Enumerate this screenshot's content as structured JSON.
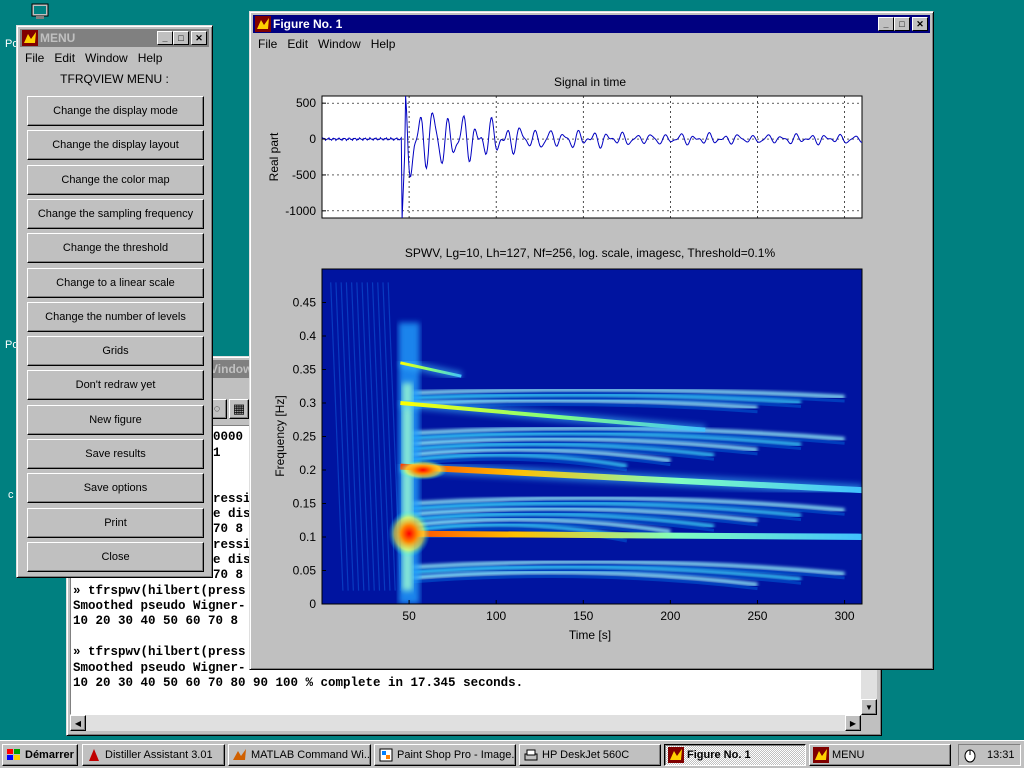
{
  "desktop": {
    "labels": [
      "Po",
      "Po",
      "c"
    ]
  },
  "menu_window": {
    "title": "MENU",
    "menus": [
      "File",
      "Edit",
      "Window",
      "Help"
    ],
    "heading": "TFRQVIEW MENU :",
    "buttons": [
      "Change the display mode",
      "Change the display layout",
      "Change the color map",
      "Change the sampling frequency",
      "Change the threshold",
      "Change to a linear scale",
      "Change the number of levels",
      "Grids",
      "Don't redraw yet",
      "New figure",
      "Save results",
      "Save options",
      "Print",
      "Close"
    ]
  },
  "command_window": {
    "title_fragment": "Vindow",
    "lines": [
      "0000",
      "1",
      "",
      "ressi",
      "e dis",
      "70 8",
      "ressi",
      "e dis",
      "70 8",
      "» tfrspwv(hilbert(press",
      "Smoothed pseudo Wigner-",
      "10 20 30 40 50 60 70 8",
      "",
      "» tfrspwv(hilbert(press",
      "Smoothed pseudo Wigner-",
      "10 20 30 40 50 60 70 80 90 100 % complete in 17.345 seconds."
    ]
  },
  "figure_window": {
    "title": "Figure No. 1",
    "menus": [
      "File",
      "Edit",
      "Window",
      "Help"
    ],
    "top_plot": {
      "title": "Signal in time",
      "ylabel": "Real part",
      "yticks": [
        "500",
        "0",
        "-500",
        "-1000"
      ]
    },
    "bottom_plot": {
      "title": "SPWV, Lg=10, Lh=127, Nf=256, log. scale, imagesc, Threshold=0.1%",
      "ylabel": "Frequency [Hz]",
      "xlabel": "Time [s]",
      "yticks": [
        "0.45",
        "0.4",
        "0.35",
        "0.3",
        "0.25",
        "0.2",
        "0.15",
        "0.1",
        "0.05",
        "0"
      ],
      "xticks": [
        "50",
        "100",
        "150",
        "200",
        "250",
        "300"
      ]
    }
  },
  "chart_data": [
    {
      "type": "line",
      "title": "Signal in time",
      "xlabel": "",
      "ylabel": "Real part",
      "ylim": [
        -1100,
        600
      ],
      "xlim": [
        0,
        310
      ],
      "grid": true,
      "x": [
        0,
        20,
        40,
        46,
        48,
        50,
        52,
        54,
        56,
        58,
        60,
        62,
        64,
        66,
        68,
        70,
        72,
        74,
        76,
        78,
        80,
        84,
        88,
        92,
        96,
        100,
        110,
        120,
        130,
        140,
        150,
        160,
        170,
        180,
        190,
        200,
        220,
        240,
        260,
        280,
        300,
        310
      ],
      "y": [
        0,
        10,
        -20,
        80,
        400,
        -1100,
        300,
        580,
        -400,
        500,
        -600,
        480,
        -500,
        420,
        -400,
        380,
        -350,
        330,
        -300,
        300,
        -250,
        250,
        -200,
        220,
        -180,
        200,
        150,
        -150,
        130,
        -120,
        110,
        -100,
        90,
        -80,
        70,
        -60,
        50,
        -40,
        40,
        -30,
        20,
        10
      ]
    },
    {
      "type": "heatmap",
      "title": "SPWV, Lg=10, Lh=127, Nf=256, log. scale, imagesc, Threshold=0.1%",
      "xlabel": "Time [s]",
      "ylabel": "Frequency [Hz]",
      "xlim": [
        0,
        310
      ],
      "ylim": [
        0,
        0.5
      ],
      "ridges": [
        {
          "freq_start": 0.105,
          "freq_end": 0.1,
          "t_start": 45,
          "t_end": 310,
          "strength": "high"
        },
        {
          "freq_start": 0.205,
          "freq_end": 0.17,
          "t_start": 45,
          "t_end": 310,
          "strength": "high"
        },
        {
          "freq_start": 0.3,
          "freq_end": 0.26,
          "t_start": 45,
          "t_end": 220,
          "strength": "medium"
        },
        {
          "freq_start": 0.36,
          "freq_end": 0.34,
          "t_start": 45,
          "t_end": 80,
          "strength": "low"
        }
      ]
    }
  ],
  "taskbar": {
    "start": "Démarrer",
    "tasks": [
      "Distiller Assistant 3.01",
      "MATLAB Command Wi...",
      "Paint Shop Pro - Image...",
      "HP DeskJet 560C",
      "Figure No. 1",
      "MENU"
    ],
    "clock": "13:31"
  }
}
